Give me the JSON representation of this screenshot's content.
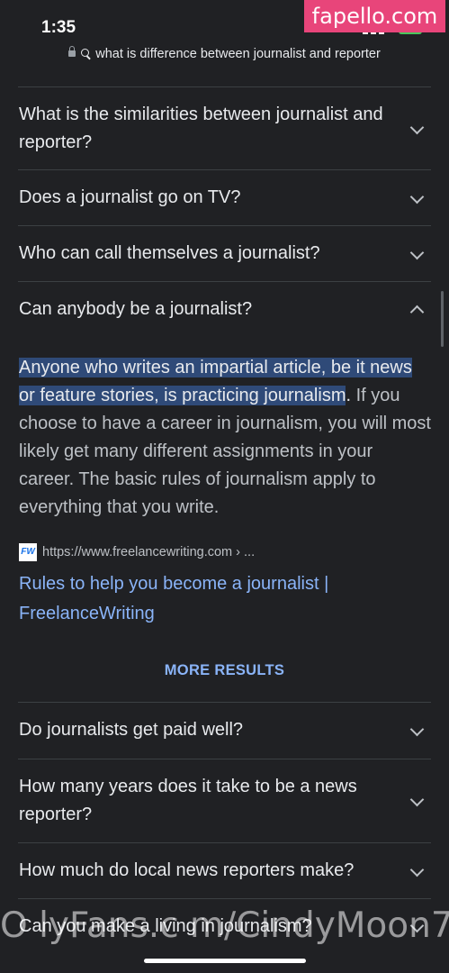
{
  "status_bar": {
    "time": "1:35"
  },
  "watermark_top": "fapello.com",
  "url_bar": {
    "query": "what is difference between journalist and reporter"
  },
  "faq": [
    {
      "question": "What is the similarities between journalist and reporter?",
      "expanded": false
    },
    {
      "question": "Does a journalist go on TV?",
      "expanded": false
    },
    {
      "question": "Who can call themselves a journalist?",
      "expanded": false
    },
    {
      "question": "Can anybody be a journalist?",
      "expanded": true
    }
  ],
  "answer": {
    "highlight": "Anyone who writes an impartial article, be it news or feature stories, is practicing journalism",
    "period": ".",
    "rest": " If you choose to have a career in journalism, you will most likely get many different assignments in your career. The basic rules of journalism apply to everything that you write."
  },
  "source": {
    "logo": "FW",
    "url": "https://www.freelancewriting.com › ...",
    "link_title": "Rules to help you become a journalist | FreelanceWriting"
  },
  "more_results": "MORE RESULTS",
  "faq_more": [
    {
      "question": "Do journalists get paid well?"
    },
    {
      "question": "How many years does it take to be a news reporter?"
    },
    {
      "question": "How much do local news reporters make?"
    },
    {
      "question": "Can you make a living in journalism?"
    }
  ],
  "watermark_bottom": "O lyFans.c m/CindyMoon7"
}
